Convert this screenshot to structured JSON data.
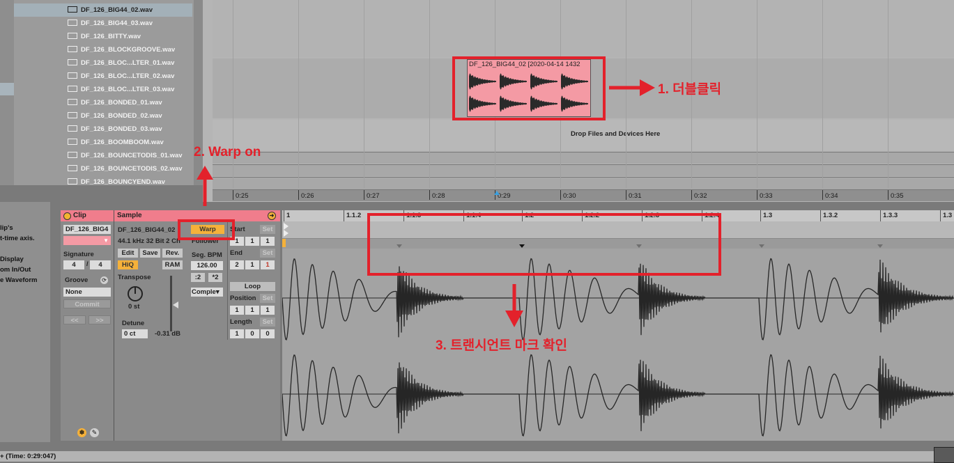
{
  "browser": {
    "files": [
      {
        "name": "DF_126_BIG44_02.wav",
        "selected": true
      },
      {
        "name": "DF_126_BIG44_03.wav"
      },
      {
        "name": "DF_126_BITTY.wav"
      },
      {
        "name": "DF_126_BLOCKGROOVE.wav"
      },
      {
        "name": "DF_126_BLOC...LTER_01.wav"
      },
      {
        "name": "DF_126_BLOC...LTER_02.wav"
      },
      {
        "name": "DF_126_BLOC...LTER_03.wav"
      },
      {
        "name": "DF_126_BONDED_01.wav"
      },
      {
        "name": "DF_126_BONDED_02.wav"
      },
      {
        "name": "DF_126_BONDED_03.wav"
      },
      {
        "name": "DF_126_BOOMBOOM.wav"
      },
      {
        "name": "DF_126_BOUNCETODIS_01.wav"
      },
      {
        "name": "DF_126_BOUNCETODIS_02.wav"
      },
      {
        "name": "DF_126_BOUNCYEND.wav"
      }
    ]
  },
  "arrangement": {
    "clip_title": "DF_126_BIG44_02 [2020-04-14 1432",
    "drop_text": "Drop Files and Devices Here",
    "time_ticks": [
      "0:25",
      "0:26",
      "0:27",
      "0:28",
      "0:29",
      "0:30",
      "0:31",
      "0:32",
      "0:33",
      "0:34",
      "0:35"
    ]
  },
  "annotations": {
    "step1": "1. 더블클릭",
    "step2": "2. Warp on",
    "step3": "3. 트랜시언트 마크 확인"
  },
  "info": {
    "lines": [
      "lip's",
      "t-time axis.",
      "Display",
      "om In/Out",
      "e Waveform"
    ]
  },
  "clip_panel": {
    "title": "Clip",
    "name": "DF_126_BIG4",
    "signature_label": "Signature",
    "sig_num": "4",
    "sig_sep": "/",
    "sig_den": "4",
    "groove_label": "Groove",
    "groove_value": "None",
    "commit": "Commit",
    "nav_left": "<<",
    "nav_right": ">>"
  },
  "sample_panel": {
    "title": "Sample",
    "file_name": "DF_126_BIG44_02",
    "file_info": "44.1 kHz 32 Bit 2 Ch",
    "edit": "Edit",
    "save": "Save",
    "rev": "Rev.",
    "hiq": "HiQ",
    "ram": "RAM",
    "transpose_label": "Transpose",
    "transpose_value": "0 st",
    "detune_label": "Detune",
    "detune_value": "0 ct",
    "gain_value": "-0.31 dB",
    "warp": "Warp",
    "follower": "Follower",
    "seg_bpm_label": "Seg. BPM",
    "seg_bpm": "126.00",
    "half": ":2",
    "double": "*2",
    "warp_mode": "Comple▾",
    "start_label": "Start",
    "set": "Set",
    "start": [
      "1",
      "1",
      "1"
    ],
    "end_label": "End",
    "end": [
      "2",
      "1",
      "1"
    ],
    "loop": "Loop",
    "position_label": "Position",
    "position": [
      "1",
      "1",
      "1"
    ],
    "length_label": "Length",
    "length": [
      "1",
      "0",
      "0"
    ]
  },
  "editor": {
    "beats": [
      "1",
      "1.1.2",
      "1.1.3",
      "1.1.4",
      "1.2",
      "1.2.2",
      "1.2.3",
      "1.2.4",
      "1.3",
      "1.3.2",
      "1.3.3",
      "1.3"
    ]
  },
  "status": {
    "text": "+ (Time: 0:29:047)"
  },
  "colors": {
    "clip_pink": "#f49aa4",
    "header_pink": "#f07d8c",
    "warp_orange": "#f5b13a",
    "annotation_red": "#e3212b"
  }
}
